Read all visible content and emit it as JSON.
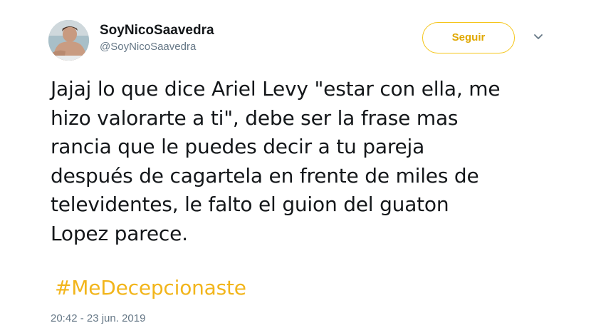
{
  "user": {
    "display_name": "SoyNicoSaavedra",
    "handle": "@SoyNicoSaavedra"
  },
  "follow_button": {
    "label": "Seguir"
  },
  "menu": {
    "icon": "chevron-down-icon"
  },
  "tweet": {
    "lines": [
      "Jajaj lo que dice Ariel Levy \"estar con ella, me",
      "hizo valorarte a ti\", debe ser la frase mas",
      "rancia que le puedes decir a tu pareja",
      "después de cagartela en frente de miles de",
      "televidentes, le falto el guion del guaton",
      "Lopez parece."
    ],
    "hashtag": "#MeDecepcionaste",
    "timestamp": "20:42 - 23 jun. 2019"
  },
  "colors": {
    "accent": "#f2b51b",
    "text": "#14171a",
    "muted": "#657786"
  }
}
